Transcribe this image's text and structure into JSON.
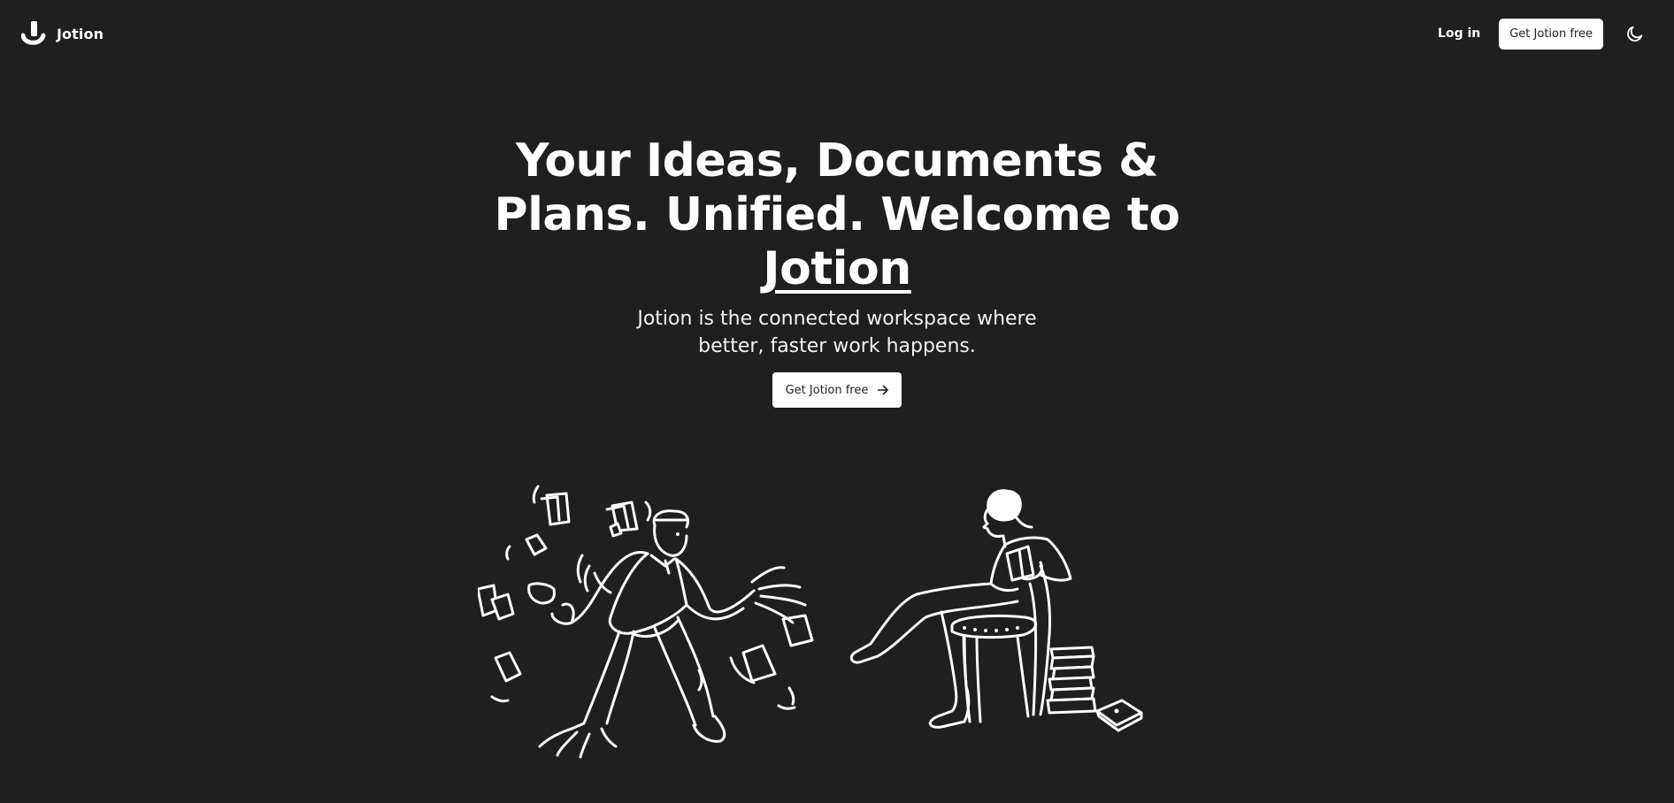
{
  "nav": {
    "brand_name": "Jotion",
    "login_label": "Log in",
    "cta_label": "Get Jotion free",
    "theme_toggle_icon": "moon-icon"
  },
  "hero": {
    "title_line": "Your Ideas, Documents & Plans. Unified. Welcome to",
    "title_brand": "Jotion",
    "subtitle": "Jotion is the connected workspace where better, faster work happens.",
    "cta_label": "Get Jotion free",
    "cta_icon": "arrow-right-icon"
  },
  "illustrations": {
    "left_icon": "juggling-papers-man-illustration",
    "right_icon": "reading-woman-illustration"
  },
  "colors": {
    "background": "#1f1f1f",
    "foreground": "#ffffff",
    "button_bg": "#ffffff",
    "button_text": "#1f1f1f"
  }
}
